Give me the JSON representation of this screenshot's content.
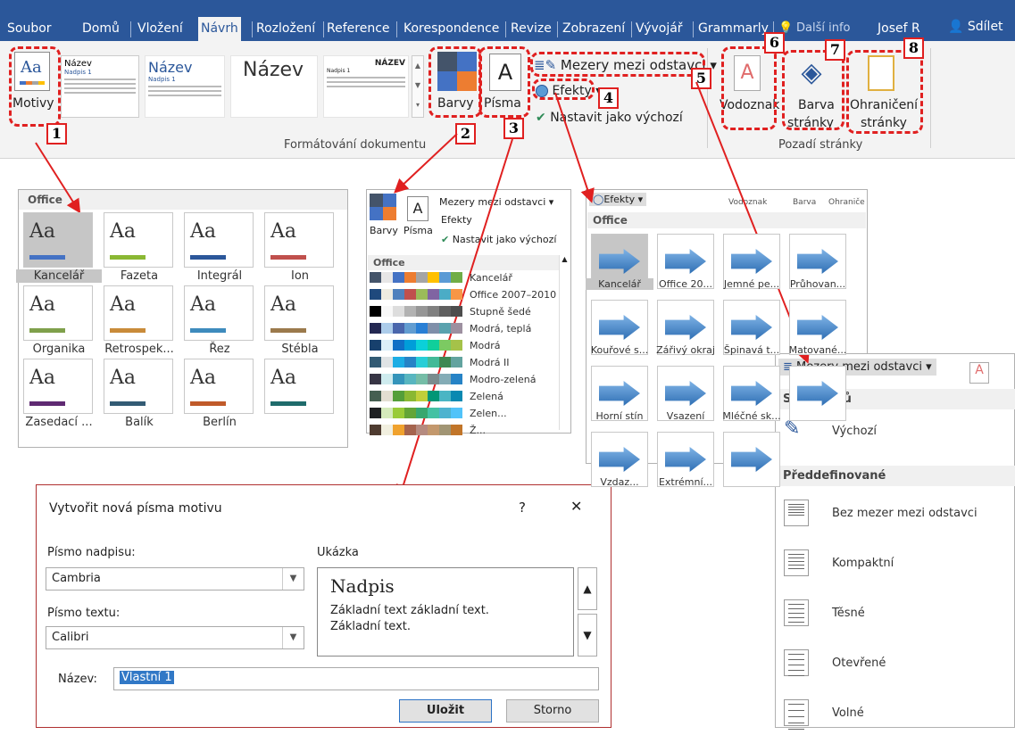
{
  "tabs": {
    "items": [
      "Soubor",
      "Domů",
      "Vložení",
      "Návrh",
      "Rozložení",
      "Reference",
      "Korespondence",
      "Revize",
      "Zobrazení",
      "Vývojář",
      "Grammarly"
    ],
    "tell_me": "Další info",
    "user": "Josef R",
    "share": "Sdílet"
  },
  "ribbon": {
    "themes_label": "Motivy",
    "styles": [
      {
        "title": "Název",
        "h": "Nadpis 1"
      },
      {
        "title": "Název",
        "h": "Nadpis 1"
      },
      {
        "title": "Název",
        "h": ""
      },
      {
        "title": "NÁZEV",
        "h": "Nadpis 1"
      }
    ],
    "colors_label": "Barvy",
    "fonts_label": "Písma",
    "fonts_glyph": "A",
    "spacing_label": "Mezery mezi odstavci",
    "effects_label": "Efekty",
    "default_label": "Nastavit jako výchozí",
    "group_format": "Formátování dokumentu",
    "watermark_label": "Vodoznak",
    "page_color_label": "Barva",
    "page_color_label2": "stránky",
    "borders_label": "Ohraničení",
    "borders_label2": "stránky",
    "group_bg": "Pozadí stránky"
  },
  "callouts": [
    "1",
    "2",
    "3",
    "4",
    "5",
    "6",
    "7",
    "8"
  ],
  "themes_panel": {
    "header": "Office",
    "items": [
      "Kancelář",
      "Fazeta",
      "Integrál",
      "Ion",
      "Organika",
      "Retrospek...",
      "Řez",
      "Stébla",
      "Zasedací ...",
      "Balík",
      "Berlín",
      ""
    ],
    "glyph": "Aa"
  },
  "colors_panel": {
    "colors": "Barvy",
    "fonts": "Písma",
    "fonts_glyph": "A",
    "spacing": "Mezery mezi odstavci",
    "effects": "Efekty",
    "default": "Nastavit jako výchozí",
    "header": "Office",
    "items": [
      {
        "name": "Kancelář",
        "c": [
          "#44546a",
          "#e7e6e6",
          "#4472c4",
          "#ed7d31",
          "#a5a5a5",
          "#ffc000",
          "#5b9bd5",
          "#70ad47"
        ]
      },
      {
        "name": "Office 2007–2010",
        "c": [
          "#1f497d",
          "#eeece1",
          "#4f81bd",
          "#c0504d",
          "#9bbb59",
          "#8064a2",
          "#4bacc6",
          "#f79646"
        ]
      },
      {
        "name": "Stupně šedé",
        "c": [
          "#000000",
          "#f8f8f8",
          "#dddddd",
          "#b2b2b2",
          "#969696",
          "#808080",
          "#5f5f5f",
          "#4d4d4d"
        ]
      },
      {
        "name": "Modrá, teplá",
        "c": [
          "#242852",
          "#acccea",
          "#4a66ac",
          "#629dd1",
          "#297fd5",
          "#7f8fa9",
          "#5aa2ae",
          "#9d90a0"
        ]
      },
      {
        "name": "Modrá",
        "c": [
          "#17406d",
          "#dbeff9",
          "#0f6fc6",
          "#009dd9",
          "#0bd0d9",
          "#10cf9b",
          "#7cca62",
          "#a5c249"
        ]
      },
      {
        "name": "Modrá II",
        "c": [
          "#335b74",
          "#dfe3e5",
          "#1cade4",
          "#2683c6",
          "#27ced7",
          "#42ba97",
          "#3e8853",
          "#62a39f"
        ]
      },
      {
        "name": "Modro-zelená",
        "c": [
          "#373545",
          "#ceebee",
          "#3494ba",
          "#58b6c0",
          "#75bda7",
          "#7a8c8e",
          "#84acb6",
          "#2683c6"
        ]
      },
      {
        "name": "Zelená",
        "c": [
          "#455f51",
          "#e3ded1",
          "#549e39",
          "#8ab833",
          "#c0cf3a",
          "#029676",
          "#4ab5c4",
          "#0989b1"
        ]
      },
      {
        "name": "Zelen...",
        "c": [
          "#1f2123",
          "#d4eabb",
          "#99cb38",
          "#63a537",
          "#37a76f",
          "#44c1a3",
          "#4eb3cf",
          "#51c3f9"
        ]
      },
      {
        "name": "Ž...",
        "c": [
          "#4e3b30",
          "#f1efdf",
          "#f0a22e",
          "#a5644e",
          "#b58b80",
          "#c3986d",
          "#a19574",
          "#c17529"
        ]
      }
    ]
  },
  "effects_panel": {
    "button": "Efekty",
    "header": "Office",
    "items": [
      "Kancelář",
      "Office 20...",
      "Jemné pe...",
      "Průhovan...",
      "Kouřové s...",
      "Zářivý okraj",
      "Špinavá t...",
      "Matované...",
      "Horní stín",
      "Vsazení",
      "Mléčné sk...",
      "",
      "Vzdaz...",
      "Extrémní...",
      ""
    ],
    "ribbon_hint1": "Vodoznak",
    "ribbon_hint2": "Barva",
    "ribbon_hint3": "Ohraniče"
  },
  "spacing_panel": {
    "button": "Mezery mezi odstavci",
    "section1": "Sada stylů",
    "default": "Výchozí",
    "section2": "Předdefinované",
    "items": [
      "Bez mezer mezi odstavci",
      "Kompaktní",
      "Těsné",
      "Otevřené",
      "Volné"
    ]
  },
  "dialog": {
    "title": "Vytvořit nová písma motivu",
    "help": "?",
    "close": "✕",
    "heading_label": "Písmo nadpisu:",
    "heading_value": "Cambria",
    "body_label": "Písmo textu:",
    "body_value": "Calibri",
    "sample_label": "Ukázka",
    "sample_heading": "Nadpis",
    "sample_line1": "Základní text základní text.",
    "sample_line2": "Základní text.",
    "name_label": "Název:",
    "name_value": "Vlastní 1",
    "save": "Uložit",
    "cancel": "Storno"
  }
}
